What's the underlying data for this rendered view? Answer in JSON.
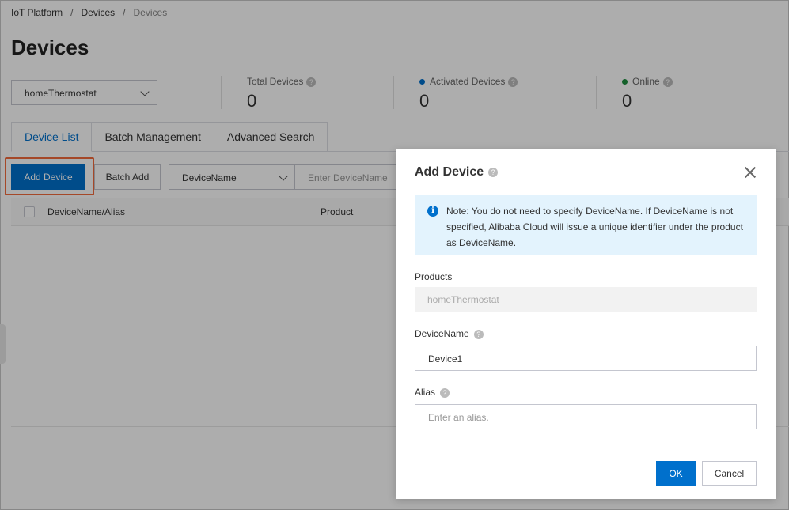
{
  "breadcrumb": [
    "IoT Platform",
    "Devices",
    "Devices"
  ],
  "page_title": "Devices",
  "product_select": {
    "value": "homeThermostat"
  },
  "stats": [
    {
      "label": "Total Devices",
      "value": "0",
      "dot_color": ""
    },
    {
      "label": "Activated Devices",
      "value": "0",
      "dot_color": "#0070cc"
    },
    {
      "label": "Online",
      "value": "0",
      "dot_color": "#1e8e3e"
    }
  ],
  "tabs": [
    "Device List",
    "Batch Management",
    "Advanced Search"
  ],
  "toolbar": {
    "add_device": "Add Device",
    "batch_add": "Batch Add",
    "filter_field": "DeviceName",
    "filter_placeholder": "Enter  DeviceName"
  },
  "table": {
    "columns": [
      "DeviceName/Alias",
      "Product"
    ]
  },
  "dialog": {
    "title": "Add Device",
    "notice": "Note: You do not need to specify DeviceName. If DeviceName is not specified, Alibaba Cloud will issue a unique identifier under the product as DeviceName.",
    "products_label": "Products",
    "products_value": "homeThermostat",
    "devicename_label": "DeviceName",
    "devicename_value": "Device1",
    "alias_label": "Alias",
    "alias_placeholder": "Enter an alias.",
    "ok": "OK",
    "cancel": "Cancel"
  },
  "colors": {
    "primary": "#0070cc",
    "highlight": "#f46a3c",
    "notice_bg": "#e3f3fd"
  }
}
